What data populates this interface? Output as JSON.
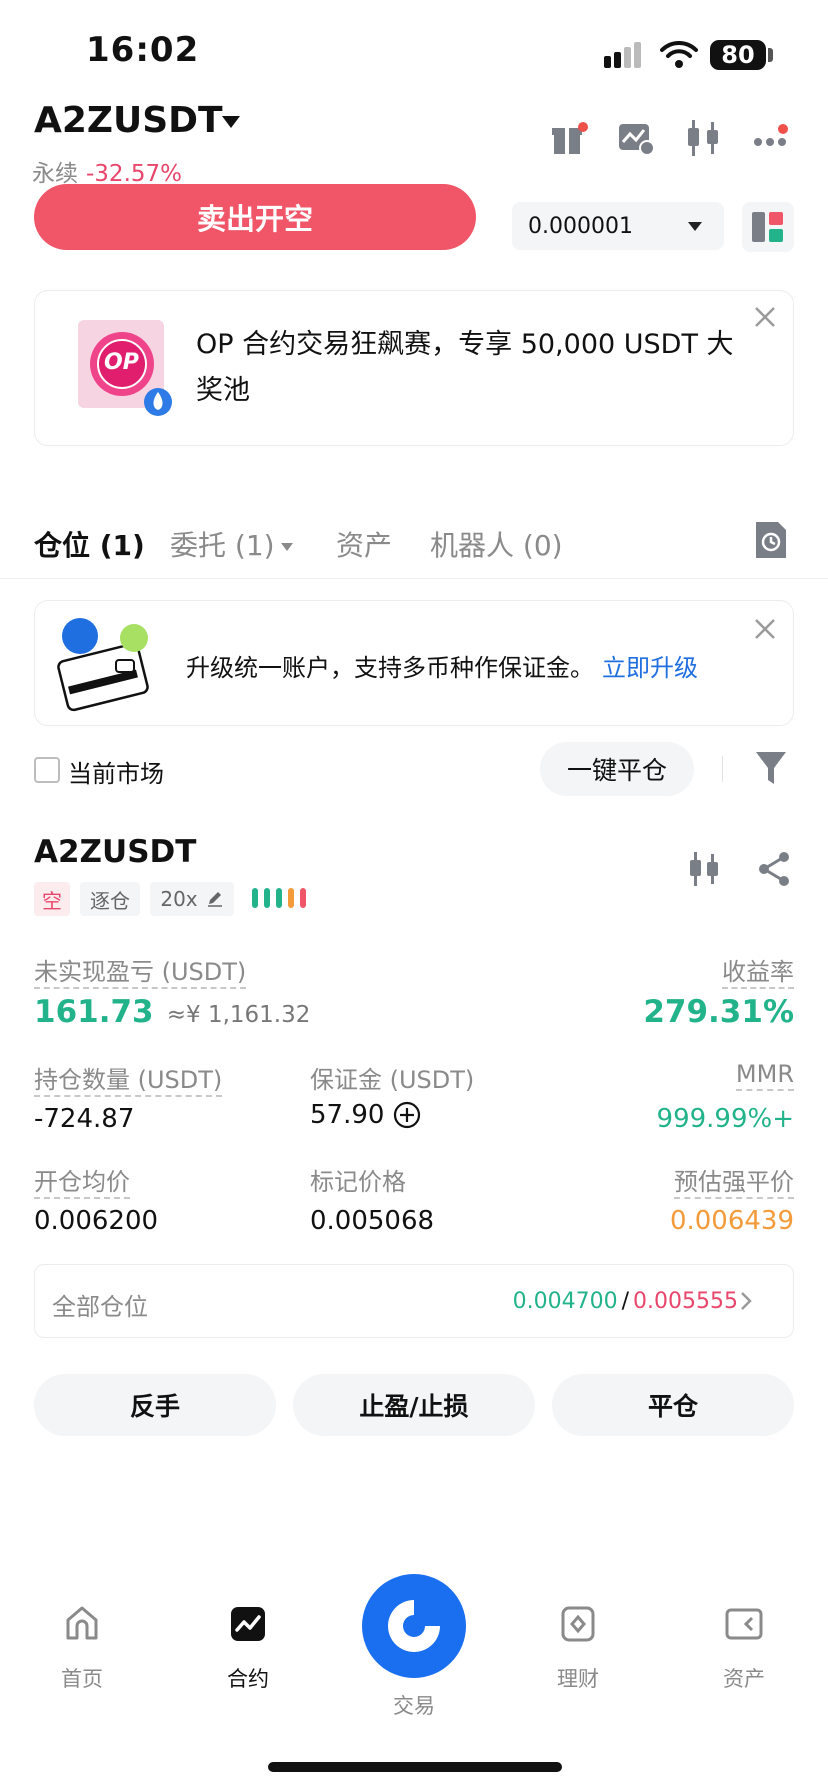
{
  "status_bar": {
    "time": "16:02",
    "battery": "80"
  },
  "header": {
    "symbol": "A2ZUSDT",
    "contract_type": "永续",
    "change_pct": "-32.57%"
  },
  "trade": {
    "sell_label": "卖出开空",
    "tick_size": "0.000001"
  },
  "promo": {
    "text": "OP 合约交易狂飙赛，专享 50,000 USDT 大奖池",
    "logo_text": "OP"
  },
  "tabs": [
    {
      "label": "仓位 (1)"
    },
    {
      "label": "委托 (1)"
    },
    {
      "label": "资产"
    },
    {
      "label": "机器人 (0)"
    }
  ],
  "upgrade": {
    "text": "升级统一账户，支持多币种作保证金。",
    "link": "立即升级"
  },
  "filter": {
    "current_market": "当前市场",
    "close_all": "一键平仓"
  },
  "position": {
    "symbol": "A2ZUSDT",
    "side": "空",
    "margin_mode": "逐仓",
    "leverage": "20x",
    "unrealized_pnl_label": "未实现盈亏 (USDT)",
    "unrealized_pnl": "161.73",
    "unrealized_pnl_cny": "≈¥ 1,161.32",
    "roe_label": "收益率",
    "roe": "279.31%",
    "size_label": "持仓数量 (USDT)",
    "size": "-724.87",
    "margin_label": "保证金 (USDT)",
    "margin": "57.90",
    "mmr_label": "MMR",
    "mmr": "999.99%+",
    "entry_label": "开仓均价",
    "entry": "0.006200",
    "mark_label": "标记价格",
    "mark": "0.005068",
    "liq_label": "预估强平价",
    "liq": "0.006439",
    "all_positions_label": "全部仓位",
    "tp": "0.004700",
    "sl": "0.005555",
    "sep": "/"
  },
  "actions": {
    "reverse": "反手",
    "tpsl": "止盈/止损",
    "close": "平仓"
  },
  "nav": [
    {
      "label": "首页",
      "icon": "home-icon"
    },
    {
      "label": "合约",
      "icon": "futures-icon"
    },
    {
      "label": "交易",
      "icon": "trade-icon"
    },
    {
      "label": "理财",
      "icon": "earn-icon"
    },
    {
      "label": "资产",
      "icon": "wallet-icon"
    }
  ],
  "colors": {
    "sell": "#f05568",
    "profit": "#22b38a",
    "loss": "#e8466b",
    "warning": "#f39b3a",
    "link": "#1f6fe0",
    "fab": "#1a6ef0"
  }
}
